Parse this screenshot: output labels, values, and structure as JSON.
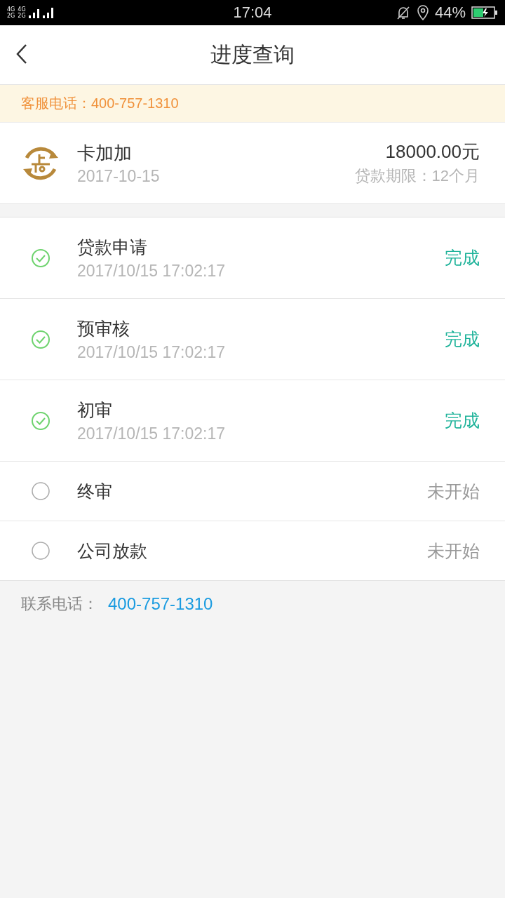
{
  "status_bar": {
    "network_labels": [
      "4G",
      "4G",
      "2G",
      "2G"
    ],
    "time": "17:04",
    "battery_percent": "44%"
  },
  "header": {
    "title": "进度查询"
  },
  "notice": {
    "label": "客服电话：",
    "phone": "400-757-1310"
  },
  "loan": {
    "name": "卡加加",
    "date": "2017-10-15",
    "amount": "18000.00元",
    "term": "贷款期限：12个月"
  },
  "steps": [
    {
      "name": "贷款申请",
      "time": "2017/10/15 17:02:17",
      "status": "完成",
      "done": true
    },
    {
      "name": "预审核",
      "time": "2017/10/15 17:02:17",
      "status": "完成",
      "done": true
    },
    {
      "name": "初审",
      "time": "2017/10/15 17:02:17",
      "status": "完成",
      "done": true
    },
    {
      "name": "终审",
      "status": "未开始",
      "done": false
    },
    {
      "name": "公司放款",
      "status": "未开始",
      "done": false
    }
  ],
  "contact": {
    "label": "联系电话：",
    "phone": "400-757-1310"
  }
}
